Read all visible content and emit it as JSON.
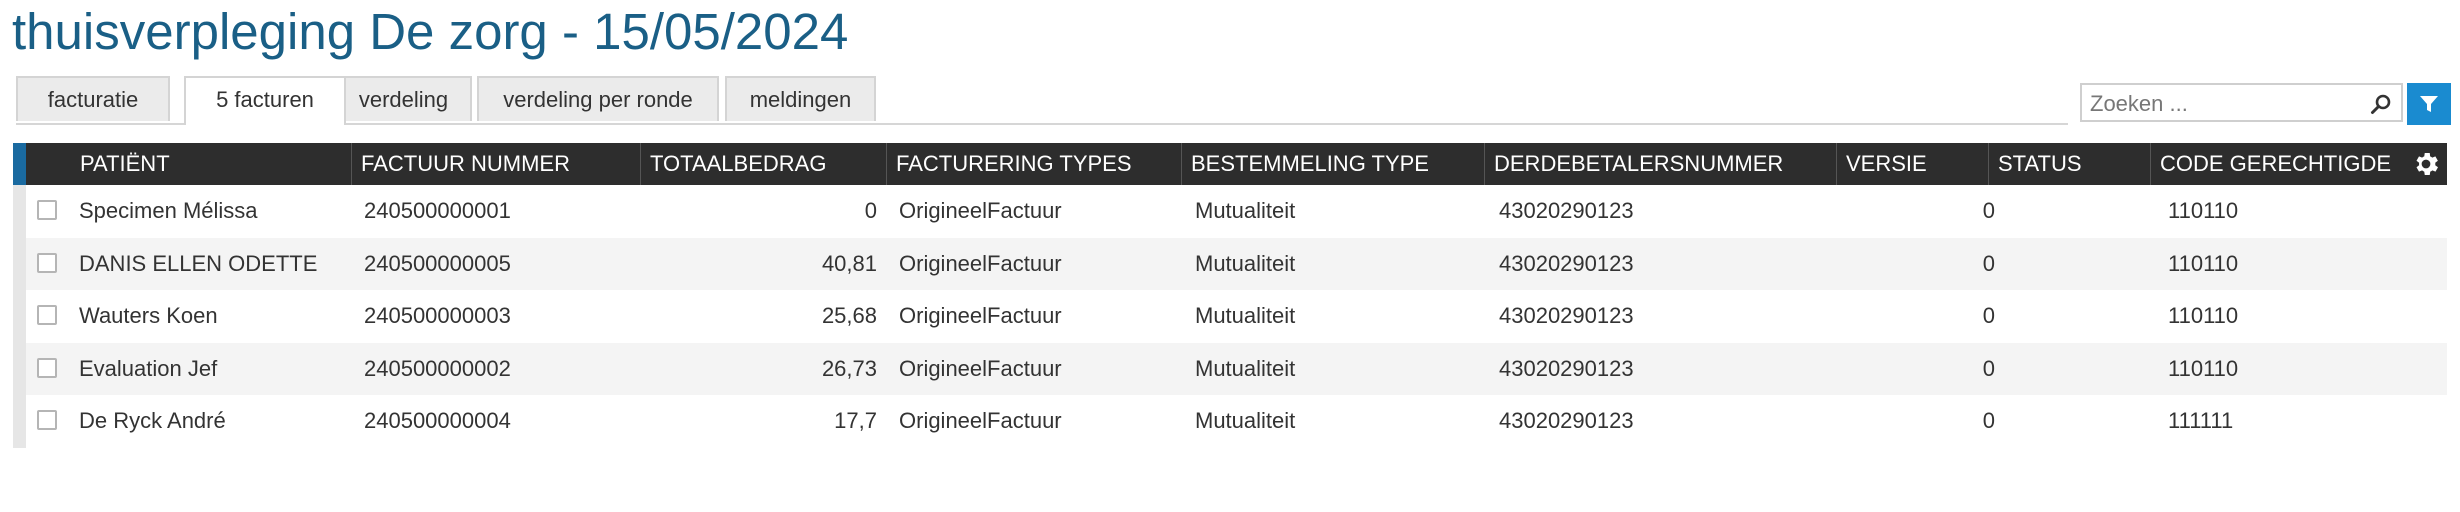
{
  "page": {
    "title": "thuisverpleging De zorg - 15/05/2024"
  },
  "tabs": [
    {
      "label": "facturatie",
      "active": false
    },
    {
      "label": "5 facturen",
      "active": true
    },
    {
      "label": "verdeling",
      "active": false
    },
    {
      "label": "verdeling per ronde",
      "active": false
    },
    {
      "label": "meldingen",
      "active": false
    }
  ],
  "search": {
    "placeholder": "Zoeken ...",
    "value": ""
  },
  "icons": {
    "search": "search-icon",
    "filter": "filter-icon",
    "settings": "gear-icon"
  },
  "colors": {
    "title": "#1a5f86",
    "accent": "#1a8bd0",
    "header_bg": "#2d2d2d"
  },
  "table": {
    "columns": [
      "PATIËNT",
      "FACTUUR NUMMER",
      "TOTAALBEDRAG",
      "FACTURERING TYPES",
      "BESTEMMELING TYPE",
      "DERDEBETALERSNUMMER",
      "VERSIE",
      "STATUS",
      "CODE GERECHTIGDE"
    ],
    "rows": [
      {
        "patient": "Specimen Mélissa",
        "factuur": "240500000001",
        "totaal": "0",
        "type": "OrigineelFactuur",
        "bestemmeling": "Mutualiteit",
        "derde": "43020290123",
        "versie": "0",
        "status": "",
        "code": "110110"
      },
      {
        "patient": "DANIS ELLEN ODETTE",
        "factuur": "240500000005",
        "totaal": "40,81",
        "type": "OrigineelFactuur",
        "bestemmeling": "Mutualiteit",
        "derde": "43020290123",
        "versie": "0",
        "status": "",
        "code": "110110"
      },
      {
        "patient": "Wauters Koen",
        "factuur": "240500000003",
        "totaal": "25,68",
        "type": "OrigineelFactuur",
        "bestemmeling": "Mutualiteit",
        "derde": "43020290123",
        "versie": "0",
        "status": "",
        "code": "110110"
      },
      {
        "patient": "Evaluation Jef",
        "factuur": "240500000002",
        "totaal": "26,73",
        "type": "OrigineelFactuur",
        "bestemmeling": "Mutualiteit",
        "derde": "43020290123",
        "versie": "0",
        "status": "",
        "code": "110110"
      },
      {
        "patient": "De Ryck André",
        "factuur": "240500000004",
        "totaal": "17,7",
        "type": "OrigineelFactuur",
        "bestemmeling": "Mutualiteit",
        "derde": "43020290123",
        "versie": "0",
        "status": "",
        "code": "111111"
      }
    ]
  }
}
